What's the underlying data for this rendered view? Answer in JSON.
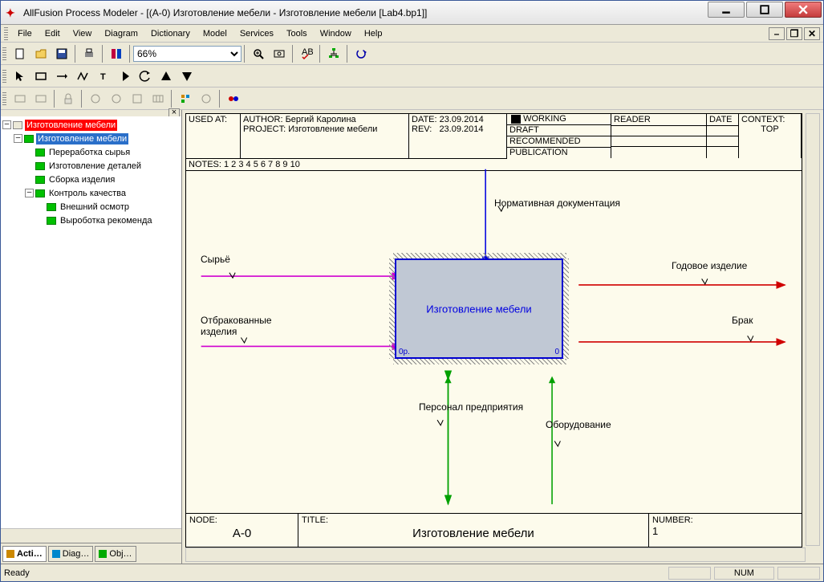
{
  "window": {
    "title": "AllFusion Process Modeler - [(A-0) Изготовление мебели - Изготовление мебели  [Lab4.bp1]]"
  },
  "menu": {
    "file": "File",
    "edit": "Edit",
    "view": "View",
    "diagram": "Diagram",
    "dictionary": "Dictionary",
    "model": "Model",
    "services": "Services",
    "tools": "Tools",
    "window": "Window",
    "help": "Help"
  },
  "toolbar": {
    "zoom": "66%"
  },
  "tree": {
    "root": "Изготовление мебели",
    "n0": "Изготовление мебели",
    "n1": "Переработка сырья",
    "n2": "Изготовление деталей",
    "n3": "Сборка изделия",
    "n4": "Контроль качества",
    "n5": "Внешний осмотр",
    "n6": "Выроботка рекоменда"
  },
  "tabs": {
    "acti": "Acti…",
    "diag": "Diag…",
    "obj": "Obj…"
  },
  "header": {
    "usedat": "USED AT:",
    "author_lbl": "AUTHOR:",
    "author": "Бергий Каролина",
    "project_lbl": "PROJECT:",
    "project": "Изготовление мебели",
    "date_lbl": "DATE:",
    "date": "23.09.2014",
    "rev_lbl": "REV:",
    "rev": "23.09.2014",
    "working": "WORKING",
    "draft": "DRAFT",
    "recommended": "RECOMMENDED",
    "publication": "PUBLICATION",
    "reader": "READER",
    "hdate": "DATE",
    "context_lbl": "CONTEXT:",
    "context_val": "TOP",
    "notes": "NOTES:  1  2  3  4  5  6  7  8  9  10"
  },
  "diagram": {
    "activity": "Изготовление мебели",
    "corner_left": "0р.",
    "corner_right": "0",
    "control": "Нормативная документация",
    "in1": "Сырьё",
    "in2": "Отбракованные изделия",
    "out1": "Годовое изделие",
    "out2": "Брак",
    "mech1": "Персонал предприятия",
    "mech2": "Оборудование"
  },
  "footer": {
    "node_lbl": "NODE:",
    "node": "A-0",
    "title_lbl": "TITLE:",
    "title": "Изготовление мебели",
    "number_lbl": "NUMBER:",
    "number": "1"
  },
  "status": {
    "ready": "Ready",
    "num": "NUM"
  }
}
